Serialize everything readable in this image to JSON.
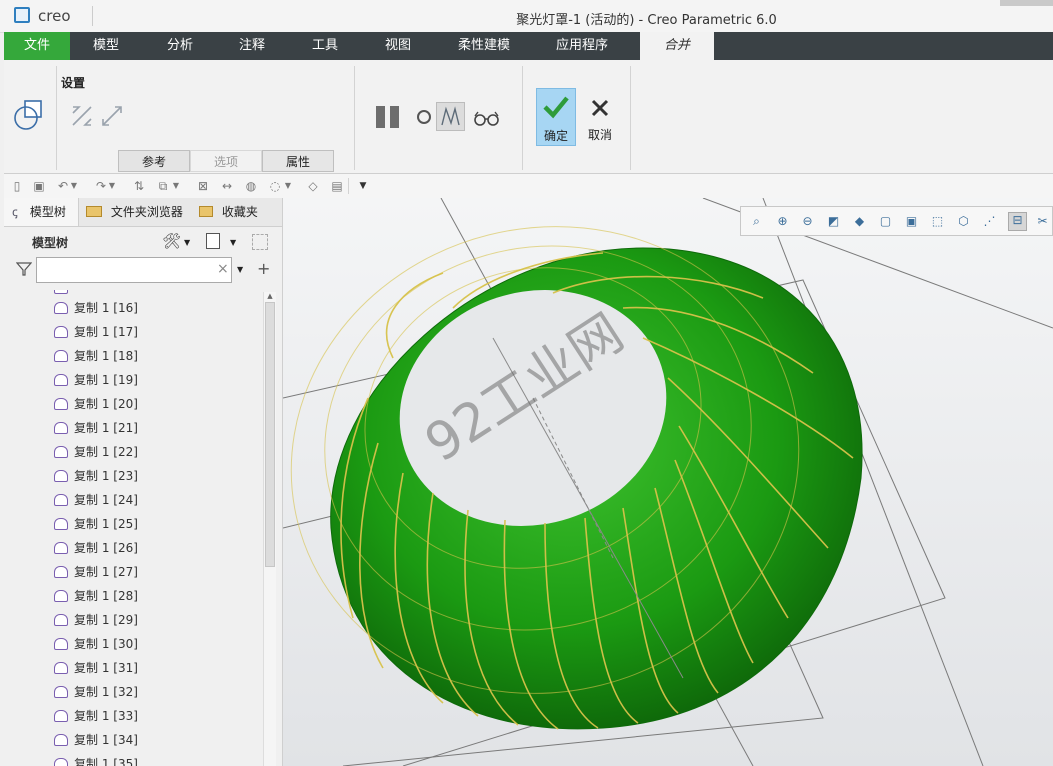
{
  "app": {
    "name": "creo",
    "title": "聚光灯罩-1 (活动的) - Creo Parametric 6.0"
  },
  "menu": {
    "items": [
      "文件",
      "模型",
      "分析",
      "注释",
      "工具",
      "视图",
      "柔性建模",
      "应用程序",
      "合并"
    ]
  },
  "ribbon": {
    "settings_label": "设置",
    "tabs": [
      "参考",
      "选项",
      "属性"
    ],
    "ok_label": "确定",
    "cancel_label": "取消",
    "colors": {
      "ok_bg": "#a7d6f3",
      "ok_check": "#2e9b3a"
    }
  },
  "left_panel": {
    "tabs": [
      "模型树",
      "文件夹浏览器",
      "收藏夹"
    ],
    "tree_label": "模型树",
    "search_value": "",
    "rows": [
      "复制 1 [16]",
      "复制 1 [17]",
      "复制 1 [18]",
      "复制 1 [19]",
      "复制 1 [20]",
      "复制 1 [21]",
      "复制 1 [22]",
      "复制 1 [23]",
      "复制 1 [24]",
      "复制 1 [25]",
      "复制 1 [26]",
      "复制 1 [27]",
      "复制 1 [28]",
      "复制 1 [29]",
      "复制 1 [30]",
      "复制 1 [31]",
      "复制 1 [32]",
      "复制 1 [33]",
      "复制 1 [34]",
      "复制 1 [35]"
    ]
  },
  "viewport": {
    "watermark": "92工业网",
    "model_color": "#1b9a12",
    "seam_color": "#d7c24a"
  }
}
